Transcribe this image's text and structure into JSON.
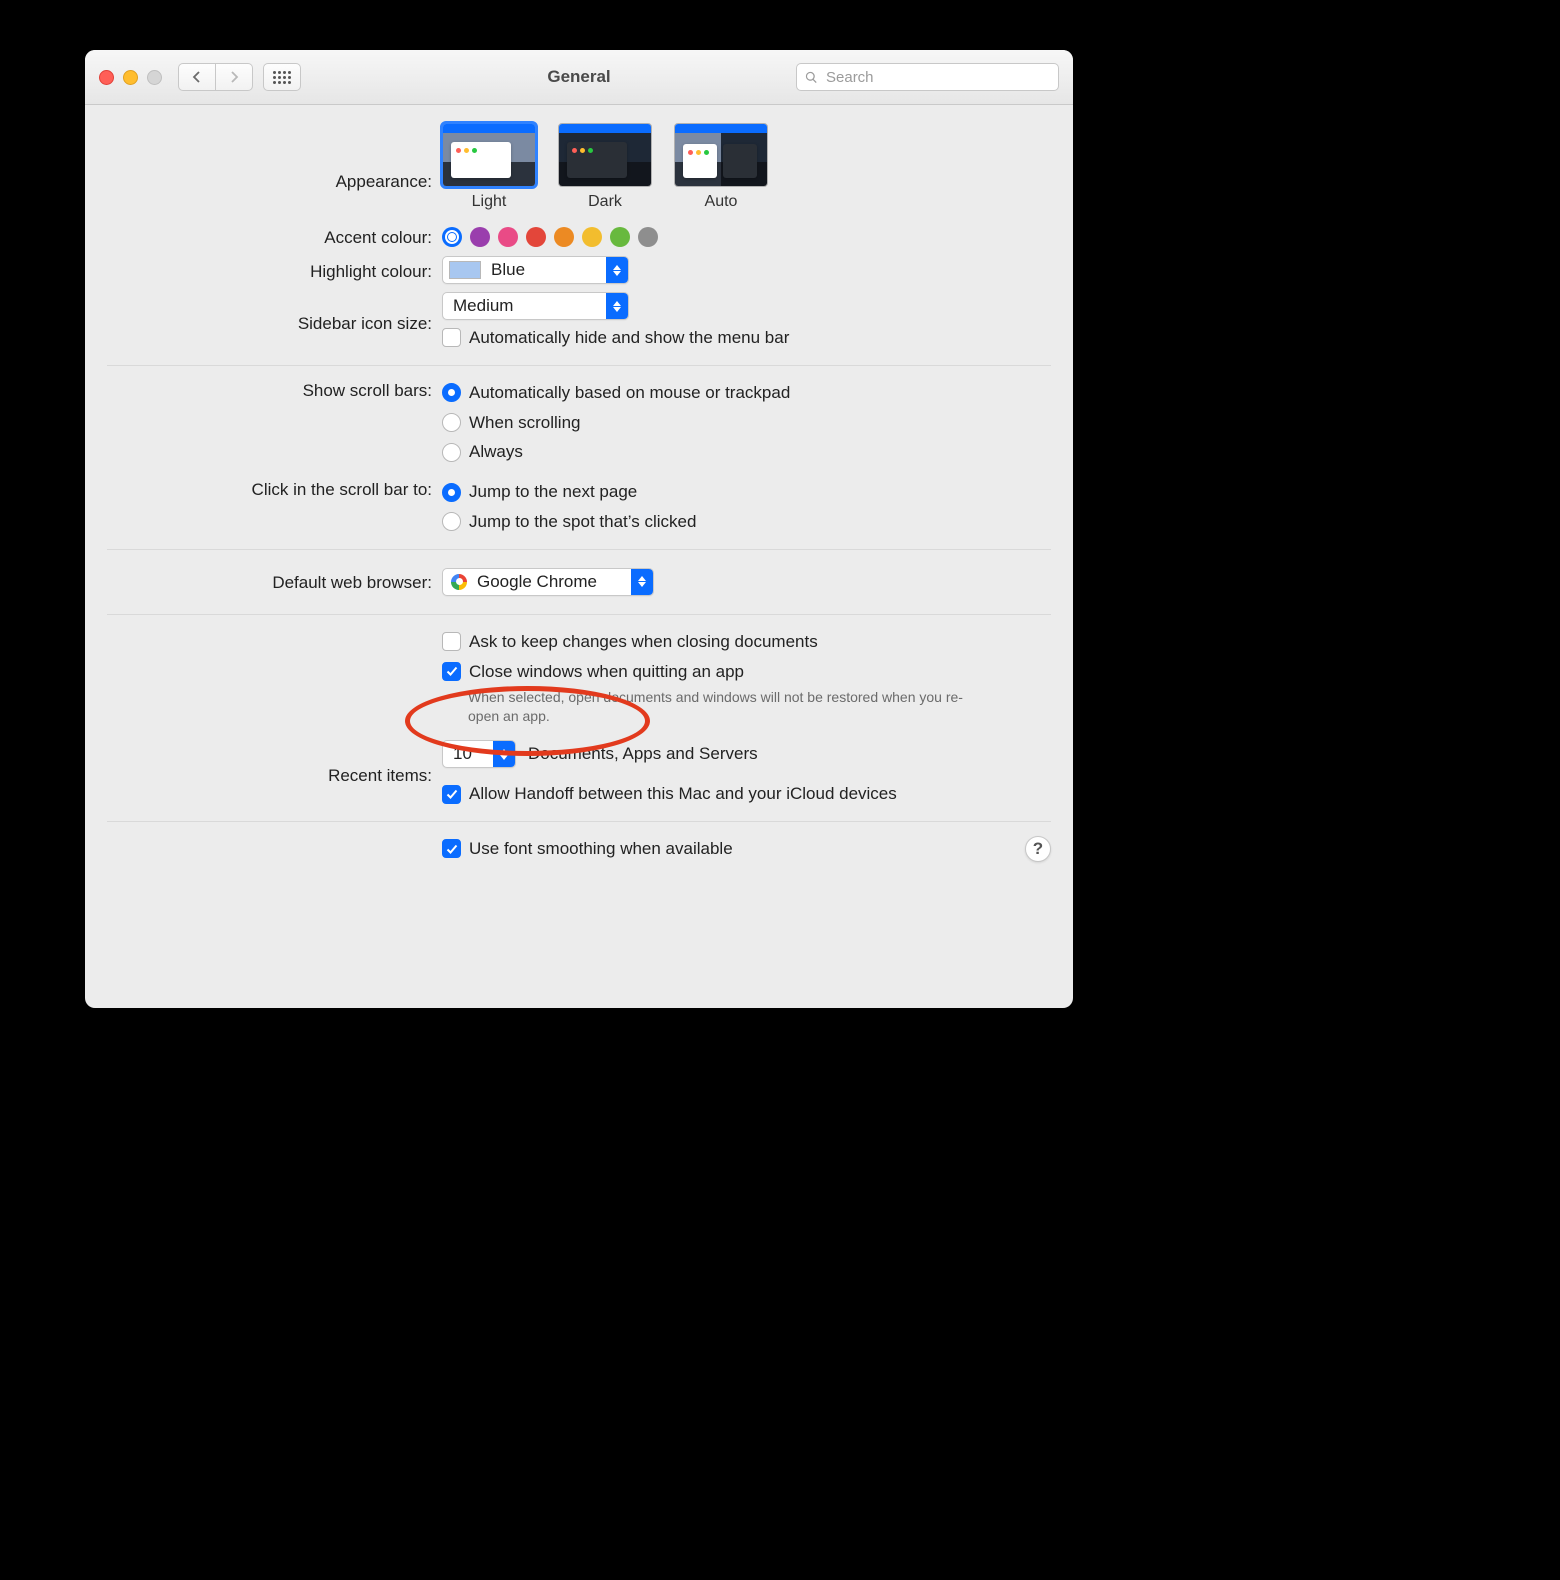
{
  "title": "General",
  "search_placeholder": "Search",
  "labels": {
    "appearance": "Appearance:",
    "accent": "Accent colour:",
    "highlight": "Highlight colour:",
    "sidebar": "Sidebar icon size:",
    "scrollbars": "Show scroll bars:",
    "click_scrollbar": "Click in the scroll bar to:",
    "browser": "Default web browser:",
    "recent": "Recent items:"
  },
  "appearance": {
    "options": [
      "Light",
      "Dark",
      "Auto"
    ],
    "selected": "Light"
  },
  "accent": {
    "colors": [
      "#0a6cff",
      "#9a3ead",
      "#e94b86",
      "#e3463a",
      "#ec8a23",
      "#f2bd2e",
      "#68b93e",
      "#8e8e8e"
    ],
    "selected_index": 0
  },
  "highlight": {
    "value": "Blue"
  },
  "sidebar_size": {
    "value": "Medium"
  },
  "menubar_autohide": {
    "label": "Automatically hide and show the menu bar",
    "checked": false
  },
  "scrollbars": {
    "options": [
      "Automatically based on mouse or trackpad",
      "When scrolling",
      "Always"
    ],
    "selected_index": 0
  },
  "click_scrollbar": {
    "options": [
      "Jump to the next page",
      "Jump to the spot that’s clicked"
    ],
    "selected_index": 0
  },
  "browser": {
    "value": "Google Chrome"
  },
  "checkboxes": {
    "ask_keep": "Ask to keep changes when closing documents",
    "close_windows": "Close windows when quitting an app",
    "close_windows_help": "When selected, open documents and windows will not be restored when you re-open an app.",
    "handoff": "Allow Handoff between this Mac and your iCloud devices",
    "font_smoothing": "Use font smoothing when available"
  },
  "recent": {
    "value": "10",
    "suffix": "Documents, Apps and Servers"
  }
}
